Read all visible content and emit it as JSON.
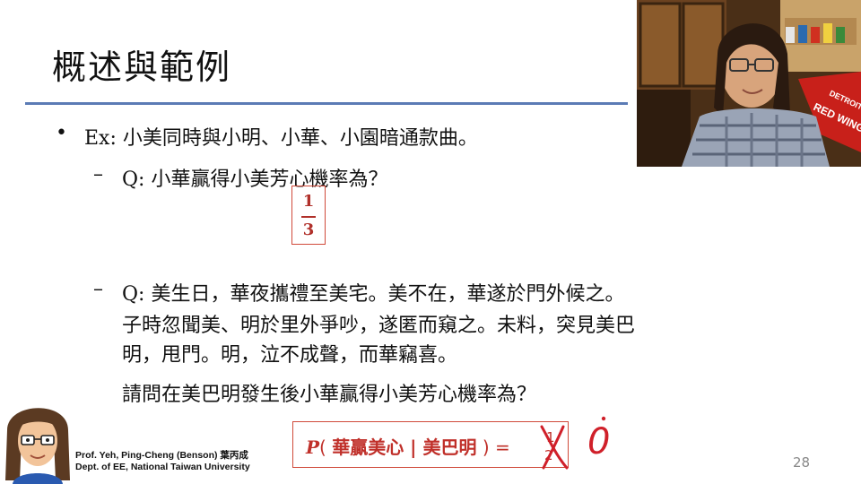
{
  "slide": {
    "title": "概述與範例",
    "bullet_symbol": "•",
    "dash_symbol": "–",
    "example_line": "Ex: 小美同時與小明、小華、小園暗通款曲。",
    "q1": "Q: 小華贏得小美芳心機率為？",
    "answer_fraction": {
      "numerator": "1",
      "denominator": "3"
    },
    "q2_lines": [
      "Q: 美生日，華夜攜禮至美宅。美不在，華遂於門外候之。",
      "子時忽聞美、明於里外爭吵，遂匿而窺之。未料，突見美巴",
      "明，甩門。明，泣不成聲，而華竊喜。",
      "請問在美巴明發生後小華贏得小美芳心機率為？"
    ],
    "formula": {
      "p_symbol": "P",
      "open_paren": "(",
      "inner": "華贏美心 | 美巴明",
      "close_equals": ") =",
      "crossed_numerator": "1",
      "crossed_denominator": "2",
      "handwritten_answer": "0"
    },
    "page_number": "28"
  },
  "footer": {
    "name_line": "Prof. Yeh, Ping-Cheng (Benson) 葉丙成",
    "dept_line": "Dept. of EE,  National Taiwan University"
  },
  "webcam": {
    "pennant_text_1": "DETROIT",
    "pennant_text_2": "RED WINGS"
  },
  "colors": {
    "title_rule": "#5b7bb5",
    "accent_red": "#d04a3a",
    "text": "#111111"
  }
}
